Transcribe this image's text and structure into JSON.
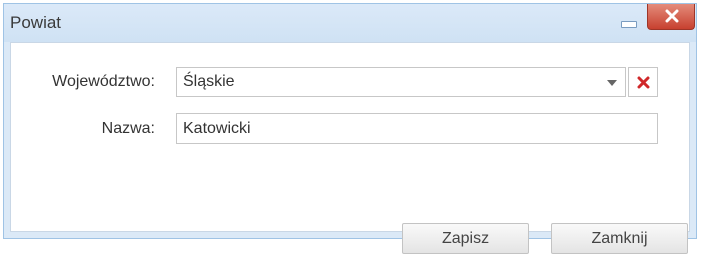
{
  "dialog": {
    "title": "Powiat",
    "buttons": {
      "minimize_icon": "minimize-icon",
      "close_icon": "close-icon"
    }
  },
  "form": {
    "voivodeship": {
      "label": "Województwo:",
      "value": "Śląskie",
      "dropdown_icon": "chevron-down-icon",
      "clear_icon": "clear-x-icon"
    },
    "name": {
      "label": "Nazwa:",
      "value": "Katowicki"
    }
  },
  "footer": {
    "save_label": "Zapisz",
    "close_label": "Zamknij"
  },
  "colors": {
    "window_frame": "#dbe9f7",
    "close_button": "#c7402f",
    "clear_icon": "#d0282a"
  }
}
